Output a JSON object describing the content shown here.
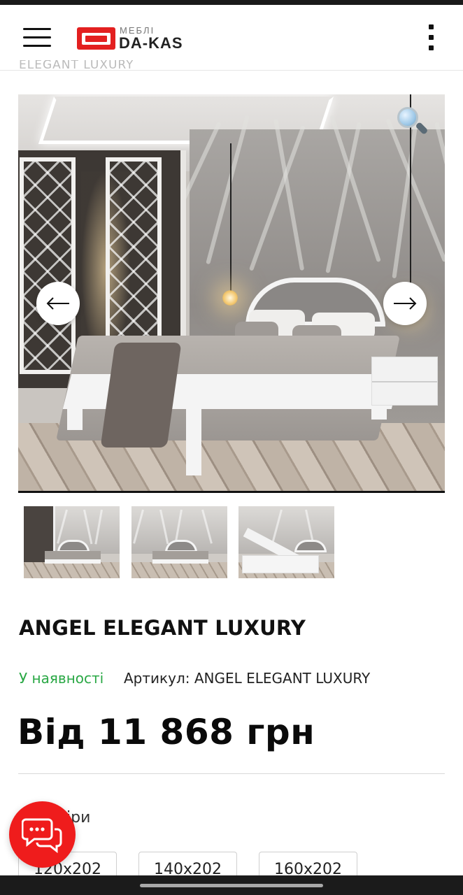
{
  "header": {
    "logo_small": "МЕБЛІ",
    "logo_big": "DA-KAS",
    "menu_icon": "hamburger-menu-icon",
    "more_icon": "vertical-dots-icon"
  },
  "breadcrumb": {
    "text": "ELEGANT LUXURY"
  },
  "gallery": {
    "prev_icon": "arrow-left-icon",
    "next_icon": "arrow-right-icon",
    "zoom_icon": "magnifier-icon",
    "thumbnails": [
      {
        "name": "bedroom-view"
      },
      {
        "name": "bed-front-view"
      },
      {
        "name": "bed-storage-lifted-view"
      }
    ]
  },
  "product": {
    "title": "ANGEL ELEGANT LUXURY",
    "stock_status": "У наявності",
    "sku": "Артикул: ANGEL ELEGANT LUXURY",
    "price": "Від 11 868 грн"
  },
  "sizes": {
    "label": "Розміри",
    "options": [
      "120x202",
      "140x202",
      "160x202"
    ]
  },
  "chat": {
    "icon": "chat-bubbles-icon"
  },
  "colors": {
    "brand": "#e32020",
    "stock": "#2aa845",
    "chat": "#ef1c1c"
  }
}
